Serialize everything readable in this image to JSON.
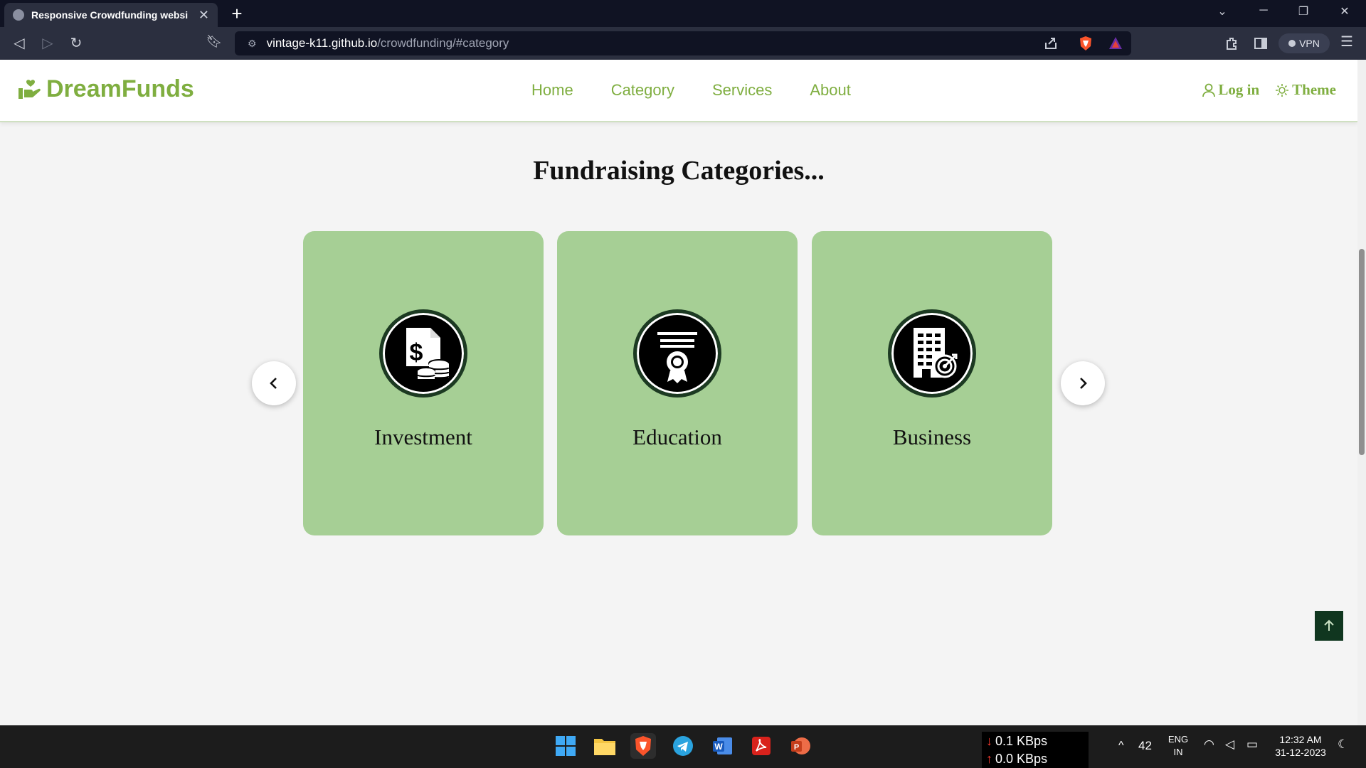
{
  "browser": {
    "tab_title": "Responsive Crowdfunding websi",
    "url_host": "vintage-k11.github.io",
    "url_path": "/crowdfunding/#category",
    "vpn_label": "VPN"
  },
  "site": {
    "brand": "DreamFunds",
    "nav": [
      "Home",
      "Category",
      "Services",
      "About"
    ],
    "login_label": "Log in",
    "theme_label": "Theme",
    "accent_color": "#7fae40"
  },
  "main": {
    "section_title": "Fundraising Categories...",
    "categories": [
      {
        "label": "Investment",
        "icon": "investment-icon"
      },
      {
        "label": "Education",
        "icon": "certificate-icon"
      },
      {
        "label": "Business",
        "icon": "business-target-icon"
      }
    ],
    "card_color": "#a6cf95"
  },
  "taskbar": {
    "net_down": "0.1 KBps",
    "net_up": "0.0 KBps",
    "weather": "42",
    "lang_top": "ENG",
    "lang_bottom": "IN",
    "time": "12:32 AM",
    "date": "31-12-2023"
  }
}
